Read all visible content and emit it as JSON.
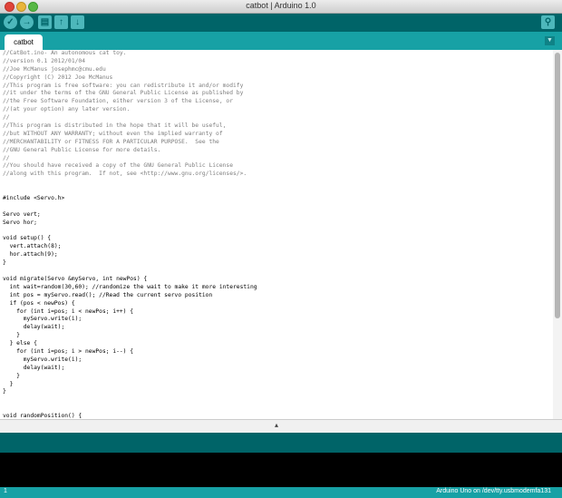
{
  "window": {
    "title": "catbot | Arduino 1.0"
  },
  "toolbar": {
    "buttons": [
      {
        "name": "verify",
        "glyph": "✓"
      },
      {
        "name": "upload",
        "glyph": "→"
      },
      {
        "name": "new",
        "glyph": "▤"
      },
      {
        "name": "open",
        "glyph": "↑"
      },
      {
        "name": "save",
        "glyph": "↓"
      }
    ],
    "serial_monitor_glyph": "⚲"
  },
  "tabs": [
    {
      "label": "catbot"
    }
  ],
  "tab_menu_glyph": "▼",
  "editor": {
    "lines": [
      "//CatBot.ino- An autonomous cat toy.",
      "//version 0.1 2012/01/04",
      "//Joe McManus josephmc@cmu.edu",
      "//Copyright (C) 2012 Joe McManus",
      "//This program is free software: you can redistribute it and/or modify",
      "//it under the terms of the GNU General Public License as published by",
      "//the Free Software Foundation, either version 3 of the License, or",
      "//(at your option) any later version.",
      "//",
      "//This program is distributed in the hope that it will be useful,",
      "//but WITHOUT ANY WARRANTY; without even the implied warranty of",
      "//MERCHANTABILITY or FITNESS FOR A PARTICULAR PURPOSE.  See the",
      "//GNU General Public License for more details.",
      "//",
      "//You should have received a copy of the GNU General Public License",
      "//along with this program.  If not, see <http://www.gnu.org/licenses/>.",
      "",
      "",
      "#include <Servo.h>",
      "",
      "Servo vert;",
      "Servo hor;",
      "",
      "void setup() {",
      "  vert.attach(8);",
      "  hor.attach(9);",
      "}",
      "",
      "void migrate(Servo &myServo, int newPos) {",
      "  int wait=random(30,60); //randomize the wait to make it more interesting",
      "  int pos = myServo.read(); //Read the current servo position",
      "  if (pos < newPos) {",
      "    for (int i=pos; i < newPos; i++) {",
      "      myServo.write(i);",
      "      delay(wait);",
      "    }",
      "  } else {",
      "    for (int i=pos; i > newPos; i--) {",
      "      myServo.write(i);",
      "      delay(wait);",
      "    }",
      "  }",
      "}",
      "",
      "",
      "void randomPosition() {"
    ]
  },
  "footer": {
    "line_number": "1",
    "board": "Arduino Uno on /dev/tty.usbmodemfa131"
  }
}
